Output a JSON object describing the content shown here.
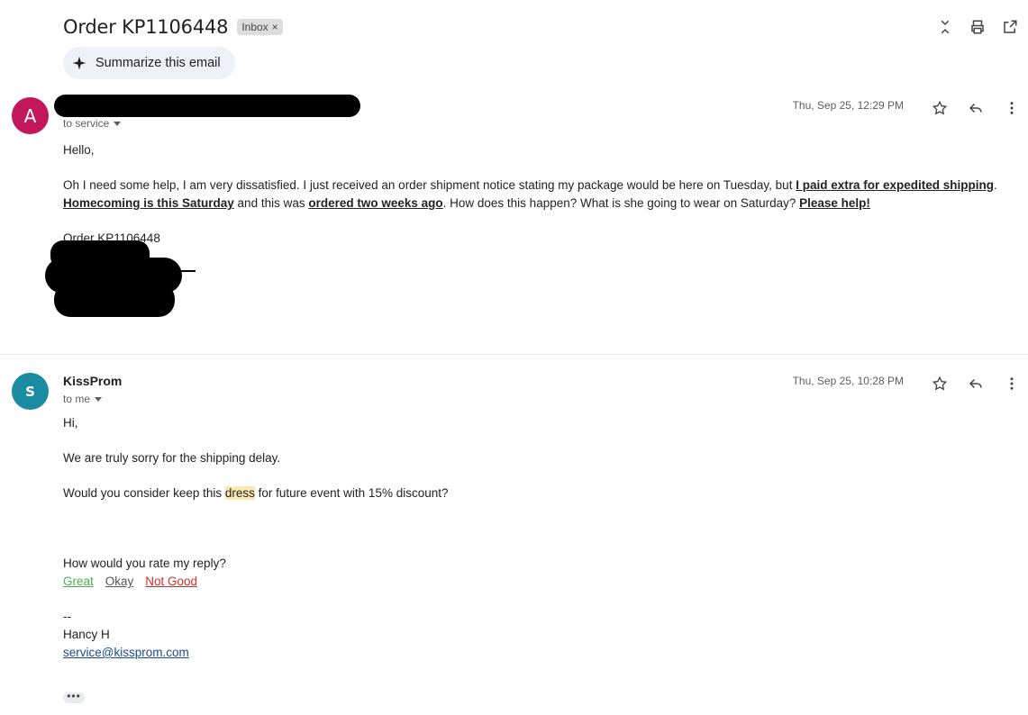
{
  "subject": "Order KP1106448",
  "label": "Inbox",
  "summarize_label": "Summarize this email",
  "messages": [
    {
      "avatar_letter": "A",
      "sender": "",
      "to": "to service",
      "date": "Thu, Sep 25, 12:29 PM",
      "greeting": "Hello,",
      "para_parts": [
        "Oh I need some help, I am very dissatisfied.  I just received an order shipment notice stating my package would be here on Tuesday, but ",
        "I paid extra for expedited shipping",
        ". ",
        "Homecoming is this Saturday",
        " and this was ",
        "ordered two weeks ago",
        ".  How does this happen?  What is she going to wear on Saturday?  ",
        "Please help!"
      ],
      "order_line": "Order KP1106448"
    },
    {
      "avatar_letter": "S",
      "sender": "KissProm",
      "to": "to me",
      "date": "Thu, Sep 25, 10:28 PM",
      "greeting": "Hi,",
      "line1": "We are truly sorry for the shipping delay.",
      "line2_before": "Would you consider keep this ",
      "line2_highlight": "dress",
      "line2_after": " for future event with 15% discount?",
      "rate_prompt": "How would you rate my reply?",
      "rate_options": [
        "Great",
        "Okay",
        "Not Good"
      ],
      "sig_dash": "--",
      "sig_name": "Hancy H",
      "sig_email": "service@kissprom.com",
      "more": "•••"
    }
  ],
  "colors": {
    "avatar_a": "#c2185b",
    "avatar_s": "#1a8ba0",
    "great": "#4caf50",
    "not_good": "#d32f2f"
  },
  "icons": [
    "collapse-icon",
    "print-icon",
    "open-new-window-icon",
    "sparkle-icon",
    "star-icon",
    "reply-icon",
    "more-vert-icon"
  ]
}
